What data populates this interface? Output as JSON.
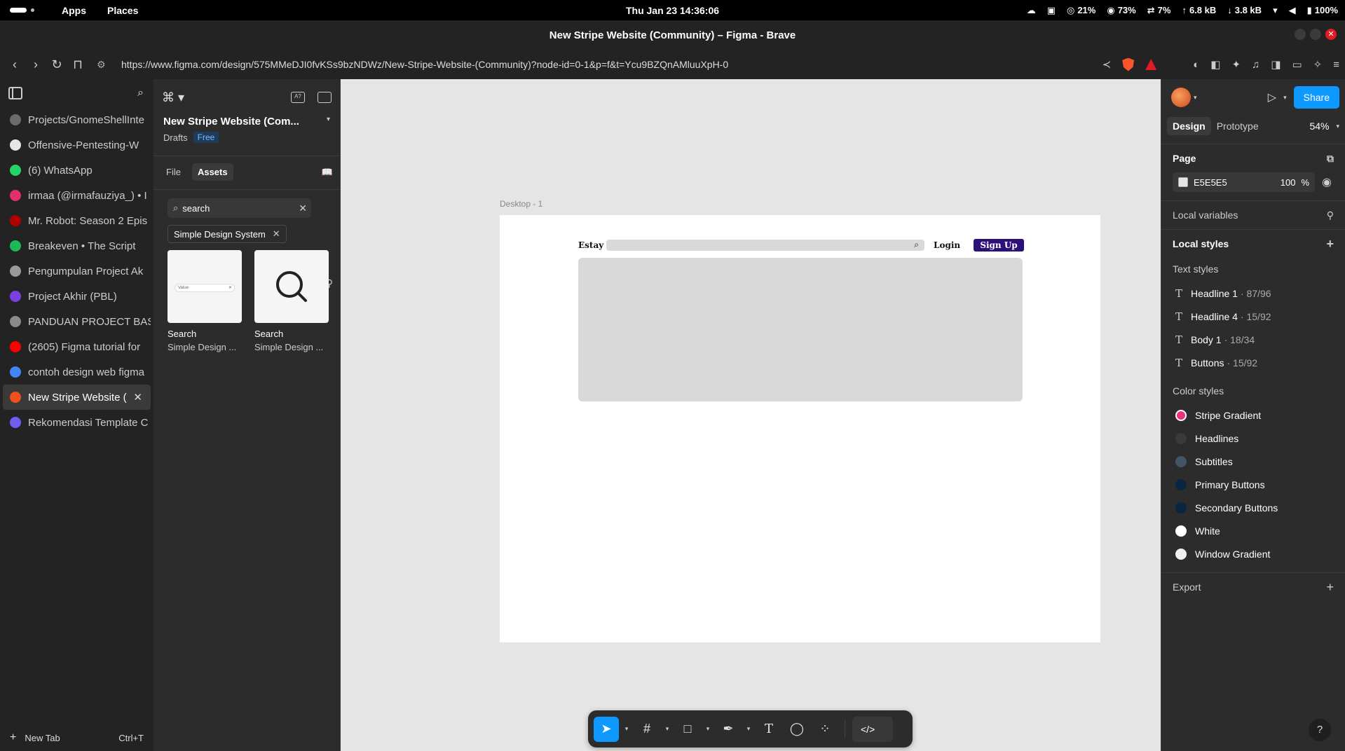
{
  "topbar": {
    "apps": "Apps",
    "places": "Places",
    "clock": "Thu Jan 23  14:36:06",
    "cpu": "21%",
    "mem": "73%",
    "swap": "7%",
    "up": "6.8 kB",
    "down": "3.8 kB",
    "battery": "100%"
  },
  "window": {
    "title": "New Stripe Website (Community) – Figma - Brave"
  },
  "browser": {
    "url": "https://www.figma.com/design/575MMeDJI0fvKSs9bzNDWz/New-Stripe-Website-(Community)?node-id=0-1&p=f&t=Ycu9BZQnAMluuXpH-0",
    "tabs": [
      {
        "label": "Projects/GnomeShellInte",
        "color": "#6b6b6b"
      },
      {
        "label": "Offensive-Pentesting-W",
        "color": "#e6e6e6"
      },
      {
        "label": "(6) WhatsApp",
        "color": "#25d366"
      },
      {
        "label": "irmaa (@irmafauziya_) • I",
        "color": "#e1306c"
      },
      {
        "label": "Mr. Robot: Season 2 Epis",
        "color": "#b00000"
      },
      {
        "label": "Breakeven • The Script",
        "color": "#1db954"
      },
      {
        "label": "Pengumpulan Project Ak",
        "color": "#9a9a9a"
      },
      {
        "label": "Project Akhir (PBL)",
        "color": "#7b3fe4"
      },
      {
        "label": "PANDUAN PROJECT BAS",
        "color": "#8a8a8a"
      },
      {
        "label": "(2605) Figma tutorial for",
        "color": "#ff0000"
      },
      {
        "label": "contoh design web figma",
        "color": "#4285f4"
      },
      {
        "label": "New Stripe Website (",
        "color": "#f24e1e"
      },
      {
        "label": "Rekomendasi Template C",
        "color": "#6f5cf0"
      }
    ],
    "new_tab": "New Tab",
    "new_tab_shortcut": "Ctrl+T"
  },
  "left_panel": {
    "file_name": "New Stripe Website (Com...",
    "drafts": "Drafts",
    "plan": "Free",
    "tab_file": "File",
    "tab_assets": "Assets",
    "search_value": "search",
    "chip": "Simple Design System",
    "assets": [
      {
        "name": "Search",
        "source": "Simple Design ...",
        "thumb_text": "Value"
      },
      {
        "name": "Search",
        "source": "Simple Design ..."
      }
    ]
  },
  "canvas": {
    "frame_label": "Desktop - 1",
    "logo": "Estay",
    "login": "Login",
    "signup": "Sign Up",
    "signup_color": "#2d0f7a",
    "bg_color": "#e5e5e5"
  },
  "right_panel": {
    "share": "Share",
    "tab_design": "Design",
    "tab_prototype": "Prototype",
    "zoom": "54%",
    "page_title": "Page",
    "page_color": "E5E5E5",
    "page_opacity": "100",
    "page_pct": "%",
    "local_variables": "Local variables",
    "local_styles": "Local styles",
    "text_styles_label": "Text styles",
    "text_styles": [
      {
        "name": "Headline 1",
        "meta": "· 87/96"
      },
      {
        "name": "Headline 4",
        "meta": "· 15/92"
      },
      {
        "name": "Body 1",
        "meta": "· 18/34"
      },
      {
        "name": "Buttons",
        "meta": "· 15/92"
      }
    ],
    "color_styles_label": "Color styles",
    "color_styles": [
      {
        "name": "Stripe Gradient",
        "color": "#e8327c"
      },
      {
        "name": "Headlines",
        "color": "#3a3a3a"
      },
      {
        "name": "Subtitles",
        "color": "#425466"
      },
      {
        "name": "Primary Buttons",
        "color": "#0a2540"
      },
      {
        "name": "Secondary Buttons",
        "color": "#0a2540"
      },
      {
        "name": "White",
        "color": "#ffffff"
      },
      {
        "name": "Window Gradient",
        "color": "#f0f0f0"
      }
    ],
    "export": "Export",
    "help": "?"
  }
}
